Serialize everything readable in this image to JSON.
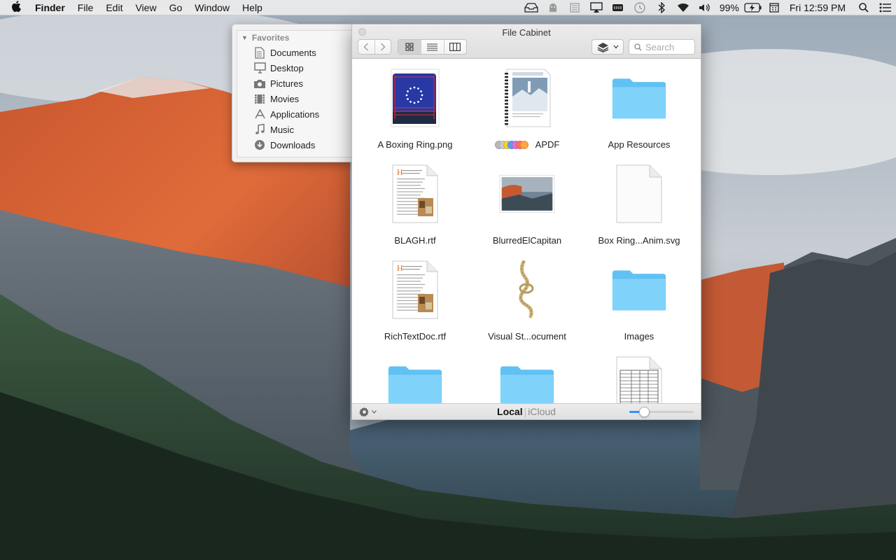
{
  "menubar": {
    "app_name": "Finder",
    "menus": [
      "File",
      "Edit",
      "View",
      "Go",
      "Window",
      "Help"
    ],
    "status_icons": [
      "file-cabinet-tray-icon",
      "ghost-icon",
      "notes-icon",
      "airplay-icon",
      "battery-status-icon",
      "time-machine-icon",
      "bluetooth-icon",
      "wifi-icon",
      "volume-icon"
    ],
    "battery_percent": "99%",
    "clock": "Fri 12:59 PM"
  },
  "sidebar": {
    "section_title": "Favorites",
    "items": [
      {
        "label": "Documents",
        "icon": "documents-icon"
      },
      {
        "label": "Desktop",
        "icon": "desktop-icon"
      },
      {
        "label": "Pictures",
        "icon": "camera-icon"
      },
      {
        "label": "Movies",
        "icon": "film-icon"
      },
      {
        "label": "Applications",
        "icon": "applications-icon"
      },
      {
        "label": "Music",
        "icon": "music-note-icon"
      },
      {
        "label": "Downloads",
        "icon": "download-icon"
      }
    ]
  },
  "window": {
    "title": "File Cabinet",
    "search_placeholder": "Search",
    "view_mode": "icon",
    "location_local": "Local",
    "location_icloud": "iCloud",
    "zoom_level": 0.18
  },
  "files": [
    {
      "name": "A Boxing Ring.png",
      "kind": "boxing-ring-image"
    },
    {
      "name": "APDF",
      "kind": "pdf-document",
      "tags": [
        "#b8b8b8",
        "#c9c9c9",
        "#f5d130",
        "#5b9bef",
        "#d474e8",
        "#ff6d5a",
        "#ffa442"
      ]
    },
    {
      "name": "App Resources",
      "kind": "folder"
    },
    {
      "name": "BLAGH.rtf",
      "kind": "rtf-document"
    },
    {
      "name": "BlurredElCapitan",
      "kind": "landscape-image"
    },
    {
      "name": "Box Ring...Anim.svg",
      "kind": "blank-document"
    },
    {
      "name": "RichTextDoc.rtf",
      "kind": "rtf-document"
    },
    {
      "name": "Visual St...ocument",
      "kind": "rope-image"
    },
    {
      "name": "Images",
      "kind": "folder"
    },
    {
      "name": "",
      "kind": "folder"
    },
    {
      "name": "",
      "kind": "folder"
    },
    {
      "name": "",
      "kind": "spreadsheet-document"
    }
  ],
  "colors": {
    "folder_blue": "#5fc2f4",
    "accent": "#3b8ff5"
  }
}
